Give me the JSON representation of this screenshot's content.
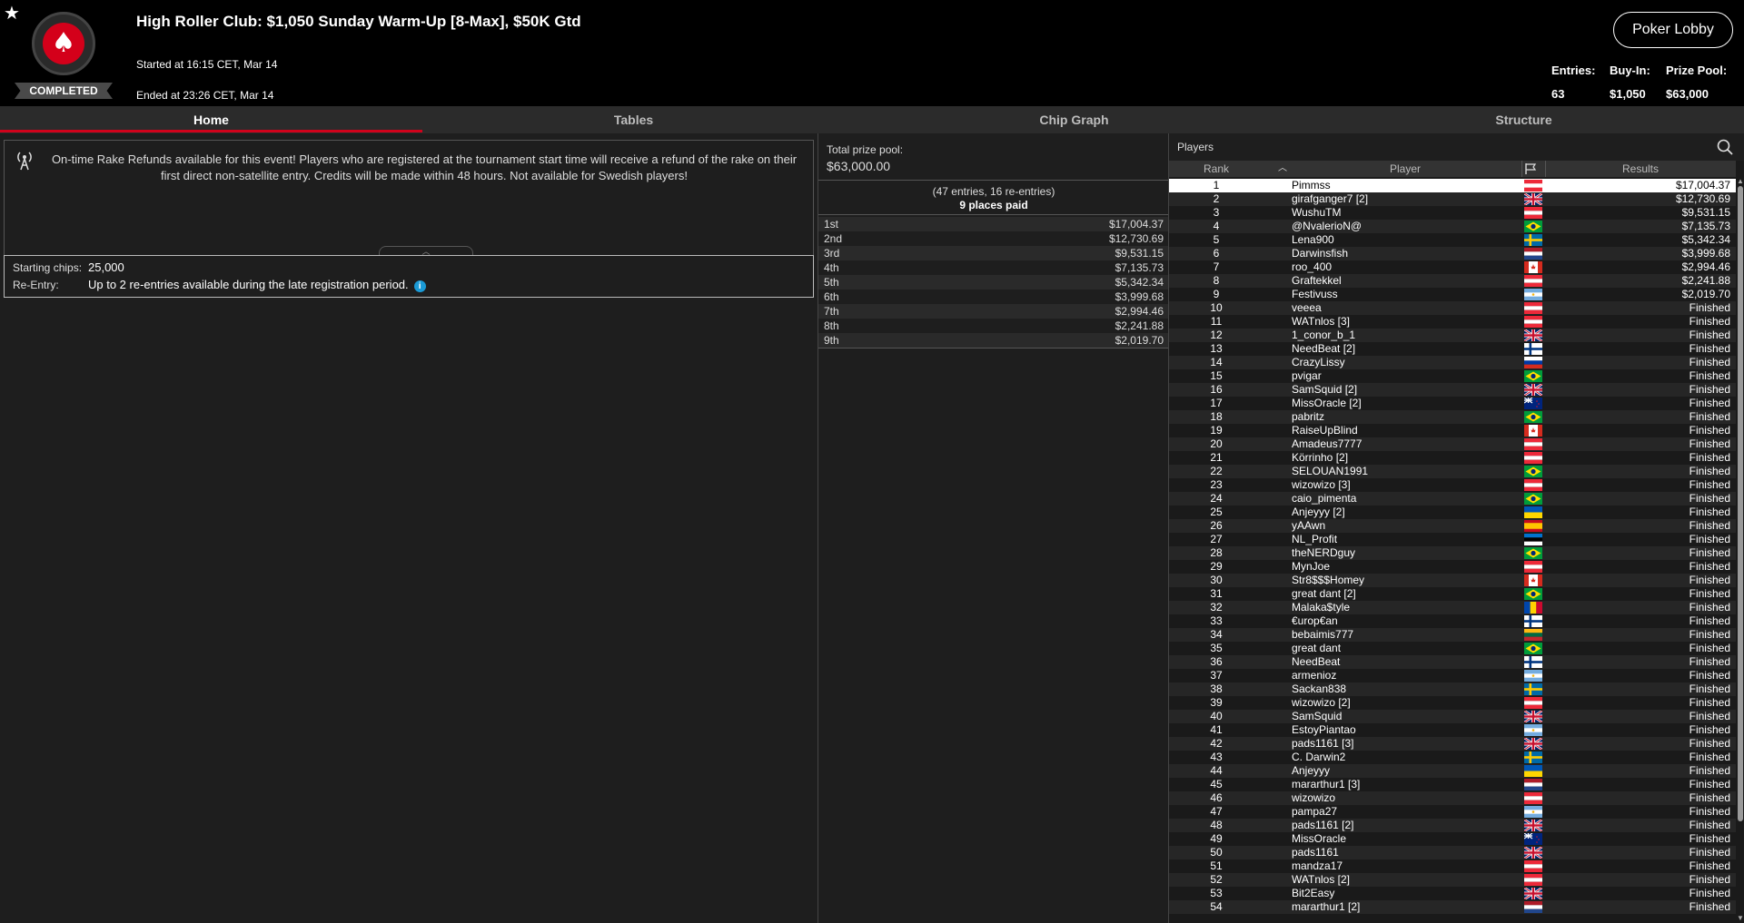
{
  "header": {
    "title": "High Roller Club: $1,050 Sunday Warm-Up [8-Max], $50K Gtd",
    "started": "Started at 16:15 CET, Mar 14",
    "ended": "Ended at 23:26 CET, Mar 14",
    "status": "COMPLETED",
    "lobby_button": "Poker Lobby",
    "entries_label": "Entries:",
    "entries_value": "63",
    "buyin_label": "Buy-In:",
    "buyin_value": "$1,050",
    "prizepool_label": "Prize Pool:",
    "prizepool_value": "$63,000",
    "icons": {
      "favorite": "star-icon",
      "logo": "pokerstars-spade-logo"
    }
  },
  "tabs": [
    {
      "label": "Home",
      "active": true
    },
    {
      "label": "Tables",
      "active": false
    },
    {
      "label": "Chip Graph",
      "active": false
    },
    {
      "label": "Structure",
      "active": false
    }
  ],
  "home": {
    "promo_text": "On-time Rake Refunds available for this event! Players who are registered at the tournament start time will receive a refund of the rake on their first direct non-satellite entry. Credits will be made within 48 hours. Not available for Swedish players!",
    "starting_chips_label": "Starting chips:",
    "starting_chips_value": "25,000",
    "reentry_label": "Re-Entry:",
    "reentry_value": "Up to 2 re-entries available during the late registration period."
  },
  "prize": {
    "total_label": "Total prize pool:",
    "total_value": "$63,000.00",
    "entries_note": "(47 entries, 16 re-entries)",
    "places_paid": "9 places paid",
    "payouts": [
      {
        "place": "1st",
        "amount": "$17,004.37"
      },
      {
        "place": "2nd",
        "amount": "$12,730.69"
      },
      {
        "place": "3rd",
        "amount": "$9,531.15"
      },
      {
        "place": "4th",
        "amount": "$7,135.73"
      },
      {
        "place": "5th",
        "amount": "$5,342.34"
      },
      {
        "place": "6th",
        "amount": "$3,999.68"
      },
      {
        "place": "7th",
        "amount": "$2,994.46"
      },
      {
        "place": "8th",
        "amount": "$2,241.88"
      },
      {
        "place": "9th",
        "amount": "$2,019.70"
      }
    ]
  },
  "players": {
    "title": "Players",
    "columns": {
      "rank": "Rank",
      "player": "Player",
      "results": "Results"
    },
    "rows": [
      {
        "rank": "1",
        "name": "Pimmss",
        "flag": "at",
        "result": "$17,004.37"
      },
      {
        "rank": "2",
        "name": "girafganger7 [2]",
        "flag": "gb",
        "result": "$12,730.69"
      },
      {
        "rank": "3",
        "name": "WushuTM",
        "flag": "at",
        "result": "$9,531.15"
      },
      {
        "rank": "4",
        "name": "@NvalerioN@",
        "flag": "br",
        "result": "$7,135.73"
      },
      {
        "rank": "5",
        "name": "Lena900",
        "flag": "se",
        "result": "$5,342.34"
      },
      {
        "rank": "6",
        "name": "Darwinsfish",
        "flag": "nl",
        "result": "$3,999.68"
      },
      {
        "rank": "7",
        "name": "roo_400",
        "flag": "ca",
        "result": "$2,994.46"
      },
      {
        "rank": "8",
        "name": "Graftekkel",
        "flag": "at",
        "result": "$2,241.88"
      },
      {
        "rank": "9",
        "name": "Festivuss",
        "flag": "ar",
        "result": "$2,019.70"
      },
      {
        "rank": "10",
        "name": "veeea",
        "flag": "at",
        "result": "Finished"
      },
      {
        "rank": "11",
        "name": "WATnlos [3]",
        "flag": "at",
        "result": "Finished"
      },
      {
        "rank": "12",
        "name": "1_conor_b_1",
        "flag": "gb",
        "result": "Finished"
      },
      {
        "rank": "13",
        "name": "NeedBeat [2]",
        "flag": "fi",
        "result": "Finished"
      },
      {
        "rank": "14",
        "name": "CrazyLissy",
        "flag": "ru",
        "result": "Finished"
      },
      {
        "rank": "15",
        "name": "pvigar",
        "flag": "br",
        "result": "Finished"
      },
      {
        "rank": "16",
        "name": "SamSquid [2]",
        "flag": "gb",
        "result": "Finished"
      },
      {
        "rank": "17",
        "name": "MissOracle [2]",
        "flag": "nz",
        "result": "Finished"
      },
      {
        "rank": "18",
        "name": "pabritz",
        "flag": "br",
        "result": "Finished"
      },
      {
        "rank": "19",
        "name": "RaiseUpBlind",
        "flag": "ca",
        "result": "Finished"
      },
      {
        "rank": "20",
        "name": "Amadeus7777",
        "flag": "at",
        "result": "Finished"
      },
      {
        "rank": "21",
        "name": "Körrinho [2]",
        "flag": "at",
        "result": "Finished"
      },
      {
        "rank": "22",
        "name": "SELOUAN1991",
        "flag": "br",
        "result": "Finished"
      },
      {
        "rank": "23",
        "name": "wizowizo [3]",
        "flag": "at",
        "result": "Finished"
      },
      {
        "rank": "24",
        "name": "caio_pimenta",
        "flag": "br",
        "result": "Finished"
      },
      {
        "rank": "25",
        "name": "Anjeyyy [2]",
        "flag": "ua",
        "result": "Finished"
      },
      {
        "rank": "26",
        "name": "yAAwn",
        "flag": "es",
        "result": "Finished"
      },
      {
        "rank": "27",
        "name": "NL_Profit",
        "flag": "ee",
        "result": "Finished"
      },
      {
        "rank": "28",
        "name": "theNERDguy",
        "flag": "br",
        "result": "Finished"
      },
      {
        "rank": "29",
        "name": "MynJoe",
        "flag": "at",
        "result": "Finished"
      },
      {
        "rank": "30",
        "name": "Str8$$$Homey",
        "flag": "ca",
        "result": "Finished"
      },
      {
        "rank": "31",
        "name": "great dant [2]",
        "flag": "br",
        "result": "Finished"
      },
      {
        "rank": "32",
        "name": "Malaka$tyle",
        "flag": "md",
        "result": "Finished"
      },
      {
        "rank": "33",
        "name": "€urop€an",
        "flag": "fi",
        "result": "Finished"
      },
      {
        "rank": "34",
        "name": "bebaimis777",
        "flag": "lt",
        "result": "Finished"
      },
      {
        "rank": "35",
        "name": "great dant",
        "flag": "br",
        "result": "Finished"
      },
      {
        "rank": "36",
        "name": "NeedBeat",
        "flag": "fi",
        "result": "Finished"
      },
      {
        "rank": "37",
        "name": "armenioz",
        "flag": "ar",
        "result": "Finished"
      },
      {
        "rank": "38",
        "name": "Sackan838",
        "flag": "se",
        "result": "Finished"
      },
      {
        "rank": "39",
        "name": "wizowizo [2]",
        "flag": "at",
        "result": "Finished"
      },
      {
        "rank": "40",
        "name": "SamSquid",
        "flag": "gb",
        "result": "Finished"
      },
      {
        "rank": "41",
        "name": "EstoyPiantao",
        "flag": "ar",
        "result": "Finished"
      },
      {
        "rank": "42",
        "name": "pads1161 [3]",
        "flag": "gb",
        "result": "Finished"
      },
      {
        "rank": "43",
        "name": "C. Darwin2",
        "flag": "se",
        "result": "Finished"
      },
      {
        "rank": "44",
        "name": "Anjeyyy",
        "flag": "ua",
        "result": "Finished"
      },
      {
        "rank": "45",
        "name": "mararthur1 [3]",
        "flag": "nl",
        "result": "Finished"
      },
      {
        "rank": "46",
        "name": "wizowizo",
        "flag": "at",
        "result": "Finished"
      },
      {
        "rank": "47",
        "name": "pampa27",
        "flag": "ar",
        "result": "Finished"
      },
      {
        "rank": "48",
        "name": "pads1161 [2]",
        "flag": "gb",
        "result": "Finished"
      },
      {
        "rank": "49",
        "name": "MissOracle",
        "flag": "nz",
        "result": "Finished"
      },
      {
        "rank": "50",
        "name": "pads1161",
        "flag": "gb",
        "result": "Finished"
      },
      {
        "rank": "51",
        "name": "mandza17",
        "flag": "at",
        "result": "Finished"
      },
      {
        "rank": "52",
        "name": "WATnlos [2]",
        "flag": "at",
        "result": "Finished"
      },
      {
        "rank": "53",
        "name": "Bit2Easy",
        "flag": "gb",
        "result": "Finished"
      },
      {
        "rank": "54",
        "name": "mararthur1 [2]",
        "flag": "nl",
        "result": "Finished"
      }
    ]
  },
  "colors": {
    "accent": "#d0021b",
    "info": "#1a9ad6",
    "background": "#1a1a1a"
  }
}
